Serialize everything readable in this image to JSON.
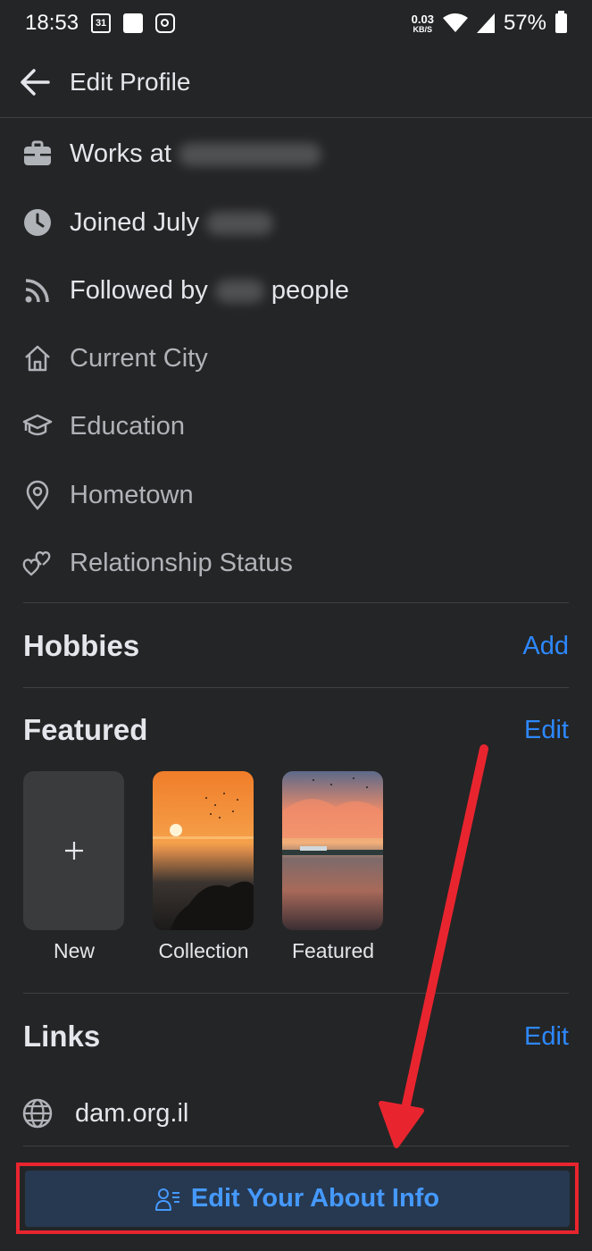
{
  "status_bar": {
    "time": "18:53",
    "calendar_day": "31",
    "net_speed_value": "0.03",
    "net_speed_unit": "KB/S",
    "battery": "57%"
  },
  "header": {
    "title": "Edit Profile"
  },
  "details": [
    {
      "label": "Works at",
      "icon": "briefcase-icon",
      "set": true
    },
    {
      "label": "Joined July",
      "icon": "clock-icon",
      "set": true
    },
    {
      "label_prefix": "Followed by",
      "label_suffix": "people",
      "icon": "rss-icon",
      "set": true
    },
    {
      "label": "Current City",
      "icon": "home-icon",
      "set": false
    },
    {
      "label": "Education",
      "icon": "graduation-cap-icon",
      "set": false
    },
    {
      "label": "Hometown",
      "icon": "location-pin-icon",
      "set": false
    },
    {
      "label": "Relationship Status",
      "icon": "hearts-icon",
      "set": false
    }
  ],
  "hobbies": {
    "title": "Hobbies",
    "action": "Add"
  },
  "featured": {
    "title": "Featured",
    "action": "Edit",
    "tiles": [
      {
        "label": "New",
        "icon": "plus-icon"
      },
      {
        "label": "Collection"
      },
      {
        "label": "Featured"
      }
    ]
  },
  "links": {
    "title": "Links",
    "action": "Edit",
    "items": [
      {
        "label": "dam.org.il",
        "icon": "globe-icon"
      }
    ]
  },
  "footer": {
    "button_label": "Edit Your About Info",
    "button_icon": "person-list-icon"
  },
  "colors": {
    "background": "#242526",
    "accent": "#2d88ff",
    "annotation": "#e8252f"
  }
}
